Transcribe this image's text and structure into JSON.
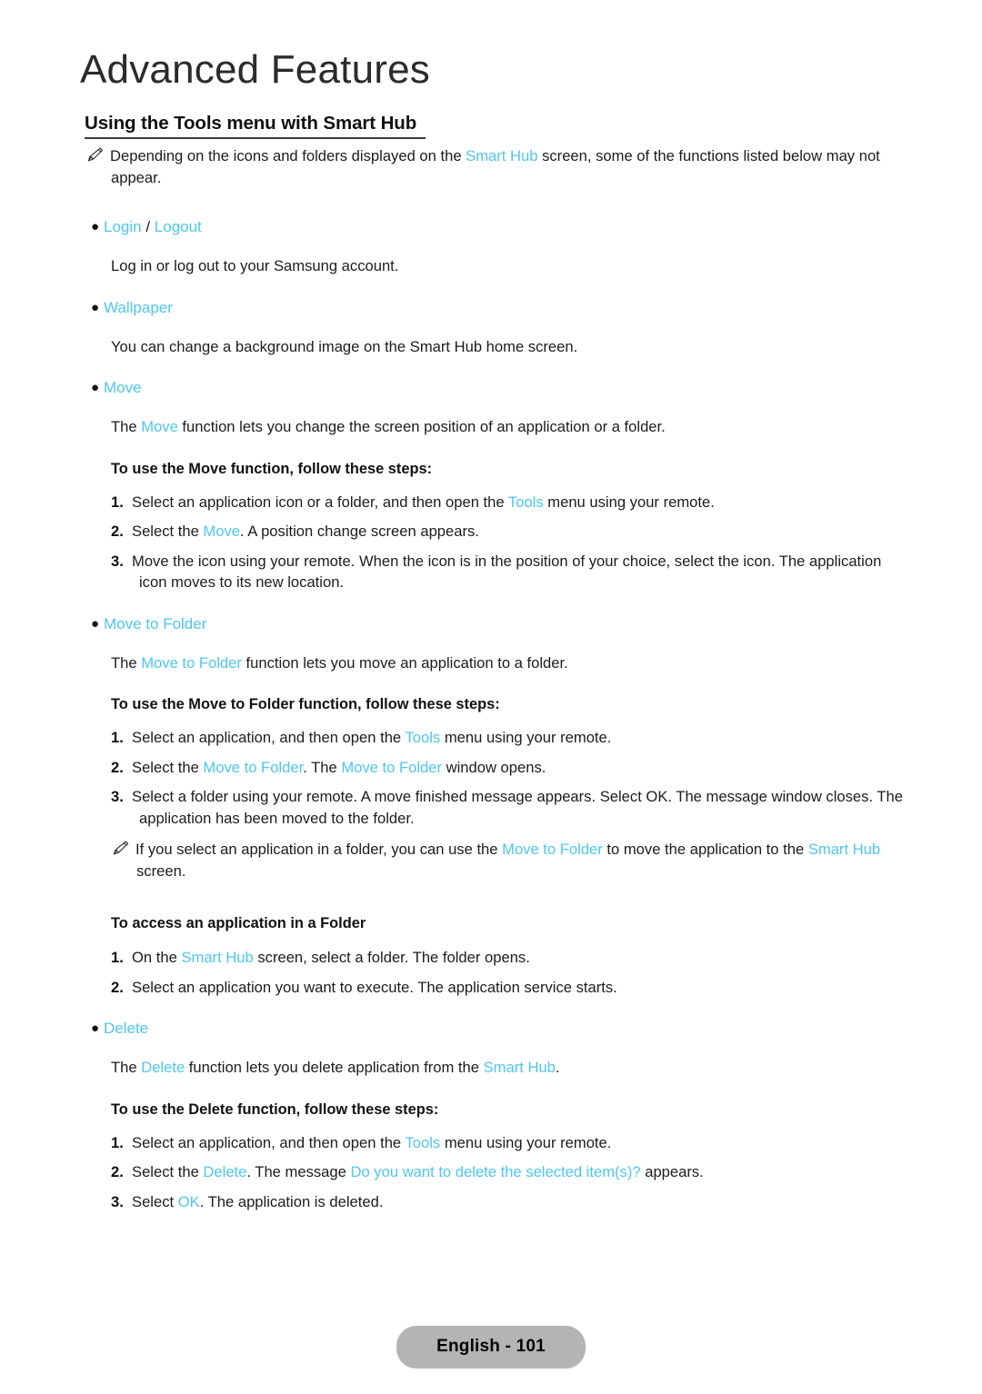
{
  "accent_color": "#4ec6f0",
  "text_color": "#1c1c1c",
  "footer_pill_color": "#b4b4b4",
  "chapter": {
    "title": "Advanced Features"
  },
  "section": {
    "heading": "Using the Tools menu with Smart Hub"
  },
  "notes": {
    "intro": {
      "icon": "pencil-note-icon",
      "text_1": "Depending on the icons and folders displayed on the ",
      "link_1": "Smart Hub",
      "text_2": " screen, some of the functions listed below may not appear."
    },
    "move_to_folder_note": {
      "icon": "pencil-note-icon",
      "text_1": "If you select an application in a folder, you can use the ",
      "link_1": "Move to Folder",
      "text_2": " to move the application to the ",
      "link_2": "Smart Hub",
      "text_3": " screen."
    }
  },
  "bullets": {
    "login_logout": {
      "label_1": "Login",
      "separator": " / ",
      "label_2": "Logout"
    },
    "wallpaper": {
      "label": "Wallpaper"
    },
    "move": {
      "label": "Move"
    },
    "move_to_folder": {
      "label": "Move to Folder"
    },
    "delete": {
      "label": "Delete"
    }
  },
  "paragraphs": {
    "login_logout_desc": "Log in or log out to your Samsung account.",
    "wallpaper_desc": "You can change a background image on the Smart Hub home screen.",
    "move_desc": {
      "pre": "The ",
      "link": "Move",
      "post": " function lets you change the screen position of an application or a folder."
    },
    "move_to_folder_desc": {
      "pre": "The ",
      "link": "Move to Folder",
      "post": " function lets you move an application to a folder."
    },
    "delete_desc": {
      "pre": "The ",
      "link_1": "Delete",
      "mid": " function lets you delete application from the ",
      "link_2": "Smart Hub",
      "post": "."
    }
  },
  "subheads": {
    "move_steps": "To use the Move function, follow these steps:",
    "move_to_folder_steps": "To use the Move to Folder function, follow these steps:",
    "access_app_in_folder": "To access an application in a Folder",
    "delete_steps": "To use the Delete function, follow these steps:"
  },
  "steps": {
    "move": [
      {
        "num": "1.",
        "pre": "Select an application icon or a folder, and then open the ",
        "link": "Tools",
        "post": " menu using your remote."
      },
      {
        "num": "2.",
        "pre": "Select the ",
        "link": "Move",
        "post": ". A position change screen appears."
      },
      {
        "num": "3.",
        "pre": "Move the icon using your remote. When the icon is in the position of your choice, select the icon. The application icon moves to its new location.",
        "link": "",
        "post": ""
      }
    ],
    "move_to_folder": [
      {
        "num": "1.",
        "pre": "Select an application, and then open the ",
        "link": "Tools",
        "post": " menu using your remote."
      },
      {
        "num": "2.",
        "pre": "Select the ",
        "link": "Move to Folder",
        "mid": ". The ",
        "link_2": "Move to Folder",
        "post": " window opens."
      },
      {
        "num": "3.",
        "pre": "Select a folder using your remote. A move finished message appears. Select OK. The message window closes. The application has been moved to the folder.",
        "link": "",
        "post": ""
      }
    ],
    "access_folder": [
      {
        "num": "1.",
        "pre": "On the ",
        "link": "Smart Hub",
        "post": " screen, select a folder. The folder opens."
      },
      {
        "num": "2.",
        "pre": "Select an application you want to execute. The application service starts.",
        "link": "",
        "post": ""
      }
    ],
    "delete": [
      {
        "num": "1.",
        "pre": "Select an application, and then open the ",
        "link": "Tools",
        "post": " menu using your remote."
      },
      {
        "num": "2.",
        "pre": "Select the ",
        "link": "Delete",
        "mid": ". The message ",
        "link_2": "Do you want to delete the selected item(s)?",
        "post": " appears."
      },
      {
        "num": "3.",
        "pre": "Select ",
        "link": "OK",
        "post": ". The application is deleted."
      }
    ]
  },
  "footer": {
    "page_label": "English - 101"
  }
}
